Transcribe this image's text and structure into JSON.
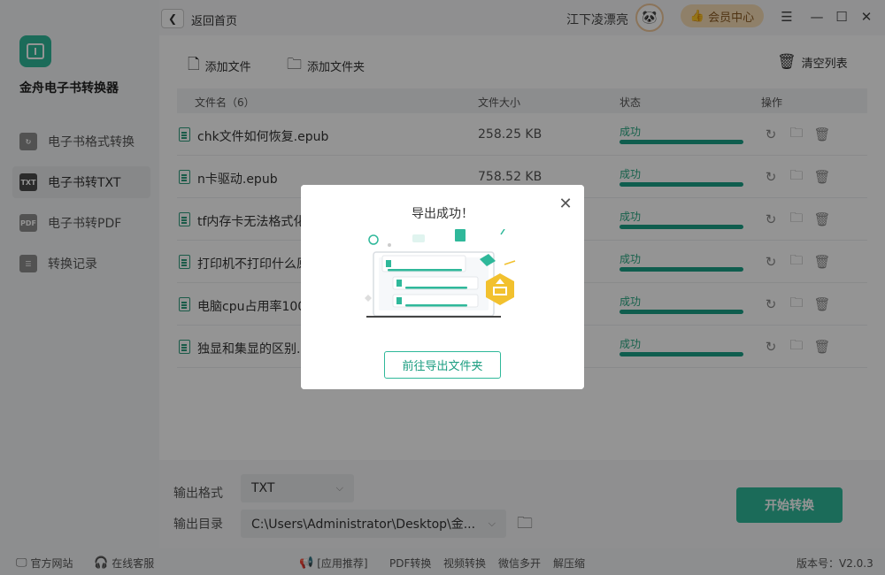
{
  "app": {
    "name": "金舟电子书转换器"
  },
  "sidebar": {
    "items": [
      {
        "label": "电子书格式转换",
        "icon": "↻"
      },
      {
        "label": "电子书转TXT",
        "icon": "TXT"
      },
      {
        "label": "电子书转PDF",
        "icon": "PDF"
      },
      {
        "label": "转换记录",
        "icon": "☰"
      }
    ]
  },
  "titlebar": {
    "back_label": "返回首页",
    "user_name": "江下凌漂亮",
    "vip_label": "会员中心",
    "menu_icon": "☰",
    "minimize_icon": "—",
    "maximize_icon": "☐",
    "close_icon": "✕"
  },
  "toolbar": {
    "add_file": "添加文件",
    "add_folder": "添加文件夹",
    "clear_list": "清空列表"
  },
  "list": {
    "columns": [
      "文件名（6）",
      "文件大小",
      "状态",
      "操作"
    ],
    "rows": [
      {
        "name": "chk文件如何恢复.epub",
        "size": "258.25 KB",
        "status": "成功",
        "progress": 1.0
      },
      {
        "name": "n卡驱动.epub",
        "size": "758.52 KB",
        "status": "成功",
        "progress": 1.0
      },
      {
        "name": "tf内存卡无法格式化",
        "size": "",
        "status": "成功",
        "progress": 1.0
      },
      {
        "name": "打印机不打印什么原",
        "size": "",
        "status": "成功",
        "progress": 1.0
      },
      {
        "name": "电脑cpu占用率100",
        "size": "",
        "status": "成功",
        "progress": 1.0
      },
      {
        "name": "独显和集显的区别.e",
        "size": "",
        "status": "成功",
        "progress": 1.0
      }
    ]
  },
  "bottom": {
    "format_label": "输出格式",
    "format_value": "TXT",
    "dir_label": "输出目录",
    "dir_value": "C:\\Users\\Administrator\\Desktop\\金...",
    "start_label": "开始转换"
  },
  "statusbar": {
    "website": "官方网站",
    "support": "在线客服",
    "recommend": "[应用推荐]",
    "links": [
      "PDF转换",
      "视频转换",
      "微信多开",
      "解压缩"
    ],
    "version": "版本号：V2.0.3"
  },
  "dialog": {
    "title": "导出成功！",
    "button": "前往导出文件夹"
  }
}
